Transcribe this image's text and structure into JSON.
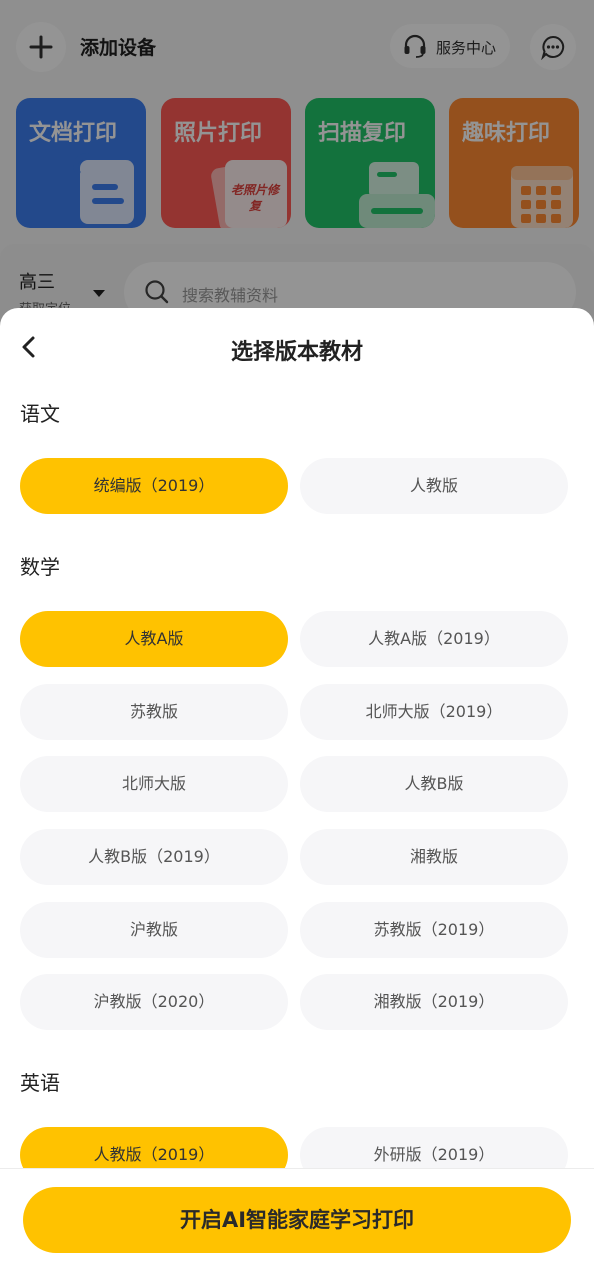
{
  "background": {
    "add_device_label": "添加设备",
    "service_center_label": "服务中心",
    "features": [
      {
        "title": "文档打印",
        "color": "#3d7ff0"
      },
      {
        "title": "照片打印",
        "color": "#ff5a55",
        "badge": "老照片修复"
      },
      {
        "title": "扫描复印",
        "color": "#22c46a"
      },
      {
        "title": "趣味打印",
        "color": "#ff8a33"
      }
    ],
    "grade": "高三",
    "locate_text": "获取定位",
    "search_placeholder": "搜索教辅资料"
  },
  "sheet": {
    "title": "选择版本教材",
    "sections": [
      {
        "subject": "语文",
        "options": [
          {
            "label": "统编版（2019）",
            "selected": true
          },
          {
            "label": "人教版",
            "selected": false
          }
        ]
      },
      {
        "subject": "数学",
        "options": [
          {
            "label": "人教A版",
            "selected": true
          },
          {
            "label": "人教A版（2019）",
            "selected": false
          },
          {
            "label": "苏教版",
            "selected": false
          },
          {
            "label": "北师大版（2019）",
            "selected": false
          },
          {
            "label": "北师大版",
            "selected": false
          },
          {
            "label": "人教B版",
            "selected": false
          },
          {
            "label": "人教B版（2019）",
            "selected": false
          },
          {
            "label": "湘教版",
            "selected": false
          },
          {
            "label": "沪教版",
            "selected": false
          },
          {
            "label": "苏教版（2019）",
            "selected": false
          },
          {
            "label": "沪教版（2020）",
            "selected": false
          },
          {
            "label": "湘教版（2019）",
            "selected": false
          }
        ]
      },
      {
        "subject": "英语",
        "options": [
          {
            "label": "人教版（2019）",
            "selected": true
          },
          {
            "label": "外研版（2019）",
            "selected": false
          }
        ]
      }
    ],
    "cta_label": "开启AI智能家庭学习打印"
  },
  "colors": {
    "accent": "#ffc200",
    "option_bg": "#f6f6f8"
  }
}
